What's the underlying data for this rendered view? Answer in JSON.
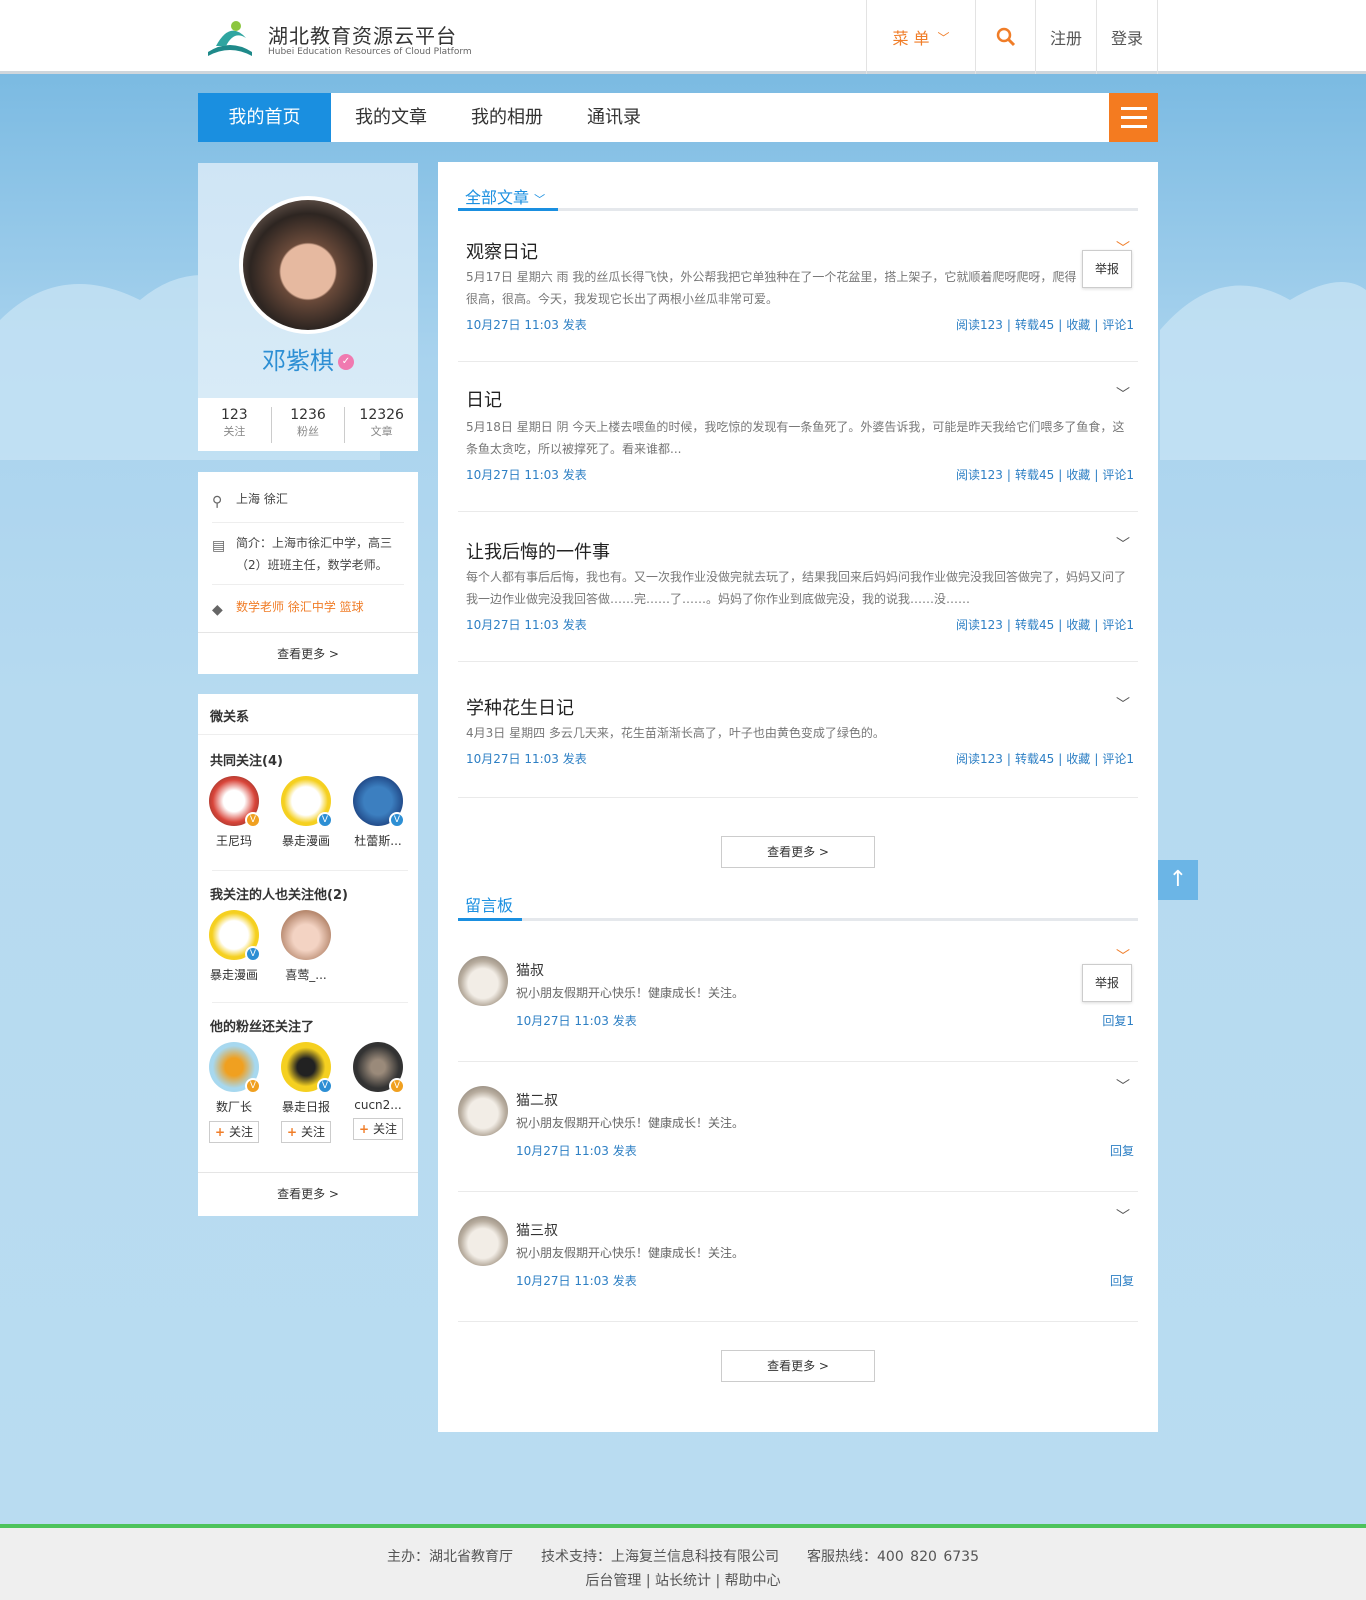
{
  "header": {
    "logo_title": "湖北教育资源云平台",
    "logo_subtitle": "Hubei Education Resources of Cloud Platform",
    "menu_label": "菜 单",
    "register": "注册",
    "login": "登录"
  },
  "tabs": [
    "我的首页",
    "我的文章",
    "我的相册",
    "通讯录"
  ],
  "profile": {
    "name": "邓紫棋",
    "stats": [
      {
        "value": "123",
        "label": "关注"
      },
      {
        "value": "1236",
        "label": "粉丝"
      },
      {
        "value": "12326",
        "label": "文章"
      }
    ]
  },
  "info": {
    "location": "上海 徐汇",
    "intro": "简介：上海市徐汇中学，高三（2）班班主任，数学老师。",
    "tags": "数学老师 徐汇中学 篮球",
    "more": "查看更多 >"
  },
  "relations": {
    "title": "微关系",
    "mutual_title": "共同关注(4)",
    "mutual": [
      "王尼玛",
      "暴走漫画",
      "杜蕾斯..."
    ],
    "also_follow_title": "我关注的人也关注他(2)",
    "also_follow": [
      "暴走漫画",
      "喜莺_..."
    ],
    "fans_follow_title": "他的粉丝还关注了",
    "fans_follow": [
      "数厂长",
      "暴走日报",
      "cucn2..."
    ],
    "follow_label": "关注",
    "more": "查看更多 >"
  },
  "articles_section": {
    "label": "全部文章",
    "articles": [
      {
        "title": "观察日记",
        "body": "5月17日 星期六 雨 我的丝瓜长得飞快，外公帮我把它单独种在了一个花盆里，搭上架子，它就顺着爬呀爬呀，爬得很高，很高。今天，我发现它长出了两根小丝瓜非常可爱。",
        "date": "10月27日 11:03 发表",
        "read": "阅读123",
        "repost": "转载45",
        "fav": "收藏",
        "comment": "评论1"
      },
      {
        "title": "日记",
        "body": "5月18日 星期日 阴 今天上楼去喂鱼的时候，我吃惊的发现有一条鱼死了。外婆告诉我，可能是昨天我给它们喂多了鱼食，这条鱼太贪吃，所以被撑死了。看来谁都...",
        "date": "10月27日 11:03 发表",
        "read": "阅读123",
        "repost": "转载45",
        "fav": "收藏",
        "comment": "评论1"
      },
      {
        "title": "让我后悔的一件事",
        "body": "每个人都有事后后悔，我也有。又一次我作业没做完就去玩了，结果我回来后妈妈问我作业做完没我回答做完了，妈妈又问了我一边作业做完没我回答做……完……了……。妈妈了你作业到底做完没，我的说我……没……",
        "date": "10月27日 11:03 发表",
        "read": "阅读123",
        "repost": "转载45",
        "fav": "收藏",
        "comment": "评论1"
      },
      {
        "title": "学种花生日记",
        "body": "4月3日 星期四 多云几天来，花生苗渐渐长高了，叶子也由黄色变成了绿色的。",
        "date": "10月27日 11:03 发表",
        "read": "阅读123",
        "repost": "转载45",
        "fav": "收藏",
        "comment": "评论1"
      }
    ],
    "report": "举报",
    "more": "查看更多 >"
  },
  "guestbook": {
    "label": "留言板",
    "comments": [
      {
        "name": "猫叔",
        "text": "祝小朋友假期开心快乐！健康成长！关注。",
        "date": "10月27日 11:03 发表",
        "reply": "回复1"
      },
      {
        "name": "猫二叔",
        "text": "祝小朋友假期开心快乐！健康成长！关注。",
        "date": "10月27日 11:03 发表",
        "reply": "回复"
      },
      {
        "name": "猫三叔",
        "text": "祝小朋友假期开心快乐！健康成长！关注。",
        "date": "10月27日 11:03 发表",
        "reply": "回复"
      }
    ],
    "report": "举报",
    "more": "查看更多 >"
  },
  "footer": {
    "host": "主办：湖北省教育厅",
    "support": "技术支持：上海复兰信息科技有限公司",
    "hotline": "客服热线：400 820 6735",
    "links": "后台管理 | 站长统计 | 帮助中心"
  },
  "colors": {
    "accent": "#1a8fe0",
    "orange": "#f47b20",
    "footer_border": "#4cc35c"
  }
}
